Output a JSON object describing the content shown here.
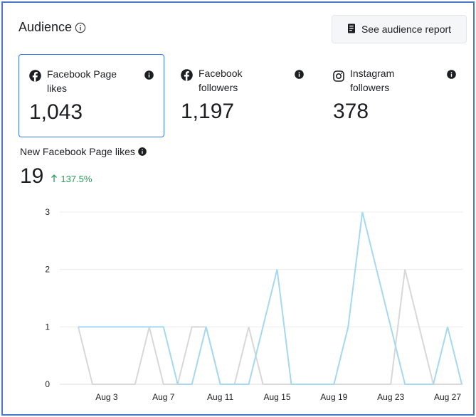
{
  "header": {
    "title": "Audience",
    "report_button_label": "See audience report"
  },
  "cards": [
    {
      "label": "Facebook Page likes",
      "value": "1,043",
      "icon": "facebook-icon",
      "selected": true
    },
    {
      "label": "Facebook followers",
      "value": "1,197",
      "icon": "facebook-icon",
      "selected": false
    },
    {
      "label": "Instagram followers",
      "value": "378",
      "icon": "instagram-icon",
      "selected": false
    }
  ],
  "metric": {
    "label": "New Facebook Page likes",
    "value": "19",
    "change": "137.5%"
  },
  "colors": {
    "accent": "#3578e5",
    "current_series": "#a6d8f0",
    "previous_series": "#d8d8d8",
    "positive": "#2b9a5a"
  },
  "chart_data": {
    "type": "line",
    "x": [
      "Aug 1",
      "Aug 2",
      "Aug 3",
      "Aug 4",
      "Aug 5",
      "Aug 6",
      "Aug 7",
      "Aug 8",
      "Aug 9",
      "Aug 10",
      "Aug 11",
      "Aug 12",
      "Aug 13",
      "Aug 14",
      "Aug 15",
      "Aug 16",
      "Aug 17",
      "Aug 18",
      "Aug 19",
      "Aug 20",
      "Aug 21",
      "Aug 22",
      "Aug 23",
      "Aug 24",
      "Aug 25",
      "Aug 26",
      "Aug 27",
      "Aug 28"
    ],
    "x_tick_labels": [
      "Aug 3",
      "Aug 7",
      "Aug 11",
      "Aug 15",
      "Aug 19",
      "Aug 23",
      "Aug 27"
    ],
    "y_ticks": [
      "0",
      "1",
      "2",
      "3"
    ],
    "ylim": [
      0,
      3
    ],
    "grid": true,
    "series": [
      {
        "values": [
          1,
          1,
          1,
          1,
          1,
          1,
          1,
          0,
          0,
          1,
          0,
          0,
          0,
          1,
          2,
          0,
          0,
          0,
          0,
          1,
          3,
          2,
          1,
          0,
          0,
          0,
          1,
          0
        ]
      },
      {
        "values": [
          1,
          0,
          0,
          0,
          0,
          1,
          0,
          0,
          1,
          1,
          0,
          0,
          1,
          0,
          0,
          0,
          0,
          0,
          0,
          0,
          0,
          0,
          0,
          2,
          1,
          0,
          0,
          0
        ]
      }
    ]
  }
}
